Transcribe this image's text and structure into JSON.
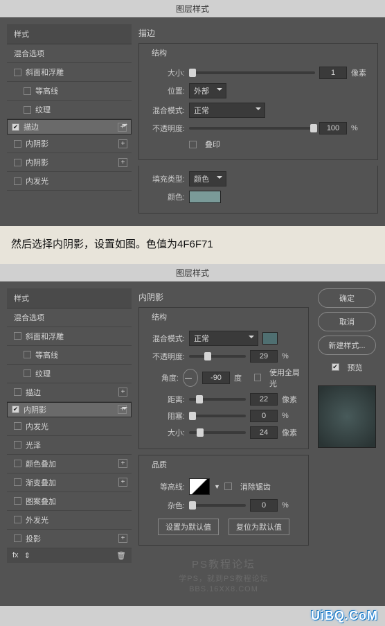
{
  "dlg1": {
    "title": "图层样式",
    "sidebar": {
      "header": "样式",
      "blend": "混合选项",
      "items": [
        {
          "label": "斜面和浮雕",
          "checked": false,
          "plus": false,
          "indent": false
        },
        {
          "label": "等高线",
          "checked": false,
          "plus": false,
          "indent": true
        },
        {
          "label": "纹理",
          "checked": false,
          "plus": false,
          "indent": true
        },
        {
          "label": "描边",
          "checked": true,
          "plus": true,
          "indent": false,
          "sel": true
        },
        {
          "label": "内阴影",
          "checked": false,
          "plus": true,
          "indent": false
        },
        {
          "label": "内阴影",
          "checked": false,
          "plus": true,
          "indent": false
        },
        {
          "label": "内发光",
          "checked": false,
          "plus": false,
          "indent": false
        }
      ]
    },
    "panel": {
      "title": "描边",
      "struct": "结构",
      "size_lbl": "大小:",
      "size_val": "1",
      "size_unit": "像素",
      "pos_lbl": "位置:",
      "pos_val": "外部",
      "blend_lbl": "混合模式:",
      "blend_val": "正常",
      "opac_lbl": "不透明度:",
      "opac_val": "100",
      "opac_unit": "%",
      "over_lbl": "叠印",
      "fill_lbl": "填充类型:",
      "fill_val": "颜色",
      "color_lbl": "颜色:",
      "color_hex": "#7a9a98"
    }
  },
  "midtext": "然后选择内阴影，设置如图。色值为4F6F71",
  "dlg2": {
    "title": "图层样式",
    "sidebar": {
      "header": "样式",
      "blend": "混合选项",
      "items": [
        {
          "label": "斜面和浮雕",
          "checked": false,
          "plus": false,
          "indent": false
        },
        {
          "label": "等高线",
          "checked": false,
          "plus": false,
          "indent": true
        },
        {
          "label": "纹理",
          "checked": false,
          "plus": false,
          "indent": true
        },
        {
          "label": "描边",
          "checked": false,
          "plus": true,
          "indent": false
        },
        {
          "label": "内阴影",
          "checked": true,
          "plus": true,
          "indent": false,
          "sel": true
        },
        {
          "label": "内发光",
          "checked": false,
          "plus": false,
          "indent": false
        },
        {
          "label": "光泽",
          "checked": false,
          "plus": false,
          "indent": false
        },
        {
          "label": "颜色叠加",
          "checked": false,
          "plus": true,
          "indent": false
        },
        {
          "label": "渐变叠加",
          "checked": false,
          "plus": true,
          "indent": false
        },
        {
          "label": "图案叠加",
          "checked": false,
          "plus": false,
          "indent": false
        },
        {
          "label": "外发光",
          "checked": false,
          "plus": false,
          "indent": false
        },
        {
          "label": "投影",
          "checked": false,
          "plus": true,
          "indent": false
        }
      ],
      "footer": "fx"
    },
    "panel": {
      "title": "内阴影",
      "struct": "结构",
      "blend_lbl": "混合模式:",
      "blend_val": "正常",
      "swatch": "#4f6f71",
      "opac_lbl": "不透明度:",
      "opac_val": "29",
      "opac_unit": "%",
      "angle_lbl": "角度:",
      "angle_val": "-90",
      "angle_unit": "度",
      "global_lbl": "使用全局光",
      "dist_lbl": "距离:",
      "dist_val": "22",
      "dist_unit": "像素",
      "choke_lbl": "阻塞:",
      "choke_val": "0",
      "choke_unit": "%",
      "size_lbl": "大小:",
      "size_val": "24",
      "size_unit": "像素",
      "quality": "品质",
      "contour_lbl": "等高线:",
      "antialias_lbl": "消除锯齿",
      "noise_lbl": "杂色:",
      "noise_val": "0",
      "noise_unit": "%",
      "btn_default": "设置为默认值",
      "btn_reset": "复位为默认值"
    },
    "right": {
      "ok": "确定",
      "cancel": "取消",
      "new_style": "新建样式...",
      "preview": "预览"
    }
  },
  "wm": {
    "title": "PS教程论坛",
    "sub1": "学PS，就到PS教程论坛",
    "sub2": "BBS.16XX8.COM",
    "brand": "UiBQ.CoM"
  }
}
